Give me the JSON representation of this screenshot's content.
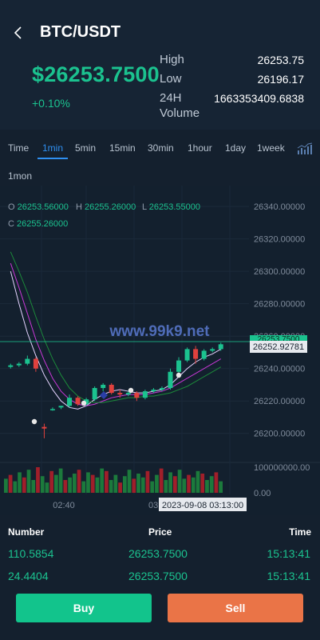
{
  "header": {
    "pair": "BTC/USDT",
    "price": "$26253.7500",
    "change": "+0.10%",
    "stats": [
      {
        "label": "High",
        "value": "26253.75"
      },
      {
        "label": "Low",
        "value": "26196.17"
      },
      {
        "label": "24H",
        "value": "1663353409.6838"
      },
      {
        "label": "Volume",
        "value": ""
      }
    ]
  },
  "tabs": [
    "Time",
    "1min",
    "5min",
    "15min",
    "30min",
    "1hour",
    "1day",
    "1week",
    "1mon"
  ],
  "active_tab": "1min",
  "ohlc": {
    "o_key": "O",
    "o": "26253.56000",
    "h_key": "H",
    "h": "26255.26000",
    "l_key": "L",
    "l": "26253.55000",
    "c_key": "C",
    "c": "26255.26000"
  },
  "watermark": "www.99k9.net",
  "price_axis": [
    "26340.00000",
    "26320.00000",
    "26300.00000",
    "26280.00000",
    "26260.00000",
    "26240.00000",
    "26220.00000",
    "26200.00000"
  ],
  "volume_axis": [
    "100000000.00",
    "0.00"
  ],
  "time_axis": [
    "02:40",
    "03"
  ],
  "crosshair_price": "26252.92781",
  "crosshair_time": "2023-09-08 03:13:00",
  "current_price_label": "26253.7500",
  "colors": {
    "up": "#1bc28f",
    "down": "#e0413e",
    "accent": "#2f8ff0",
    "buy": "#12c48c",
    "sell": "#ea7447"
  },
  "chart_data": {
    "type": "candlestick",
    "ylim": [
      26190,
      26345
    ],
    "candles": [
      {
        "o": 26241,
        "h": 26243,
        "l": 26240,
        "c": 26242
      },
      {
        "o": 26242,
        "h": 26244,
        "l": 26241,
        "c": 26243
      },
      {
        "o": 26243,
        "h": 26248,
        "l": 26242,
        "c": 26246
      },
      {
        "o": 26246,
        "h": 26247,
        "l": 26238,
        "c": 26240
      },
      {
        "o": 26204,
        "h": 26206,
        "l": 26197,
        "c": 26203
      },
      {
        "o": 26215,
        "h": 26216,
        "l": 26214,
        "c": 26215
      },
      {
        "o": 26216,
        "h": 26217,
        "l": 26215,
        "c": 26217
      },
      {
        "o": 26217,
        "h": 26224,
        "l": 26216,
        "c": 26222
      },
      {
        "o": 26222,
        "h": 26223,
        "l": 26217,
        "c": 26218
      },
      {
        "o": 26218,
        "h": 26222,
        "l": 26217,
        "c": 26221
      },
      {
        "o": 26221,
        "h": 26229,
        "l": 26220,
        "c": 26228
      },
      {
        "o": 26228,
        "h": 26231,
        "l": 26226,
        "c": 26230
      },
      {
        "o": 26230,
        "h": 26231,
        "l": 26224,
        "c": 26225
      },
      {
        "o": 26225,
        "h": 26227,
        "l": 26222,
        "c": 26224
      },
      {
        "o": 26224,
        "h": 26226,
        "l": 26223,
        "c": 26225
      },
      {
        "o": 26225,
        "h": 26226,
        "l": 26220,
        "c": 26222
      },
      {
        "o": 26222,
        "h": 26227,
        "l": 26221,
        "c": 26226
      },
      {
        "o": 26226,
        "h": 26228,
        "l": 26225,
        "c": 26227
      },
      {
        "o": 26227,
        "h": 26229,
        "l": 26226,
        "c": 26228
      },
      {
        "o": 26228,
        "h": 26240,
        "l": 26227,
        "c": 26238
      },
      {
        "o": 26238,
        "h": 26247,
        "l": 26236,
        "c": 26245
      },
      {
        "o": 26245,
        "h": 26253,
        "l": 26244,
        "c": 26252
      },
      {
        "o": 26252,
        "h": 26254,
        "l": 26243,
        "c": 26246
      },
      {
        "o": 26246,
        "h": 26252,
        "l": 26245,
        "c": 26251
      },
      {
        "o": 26251,
        "h": 26253,
        "l": 26250,
        "c": 26252
      },
      {
        "o": 26252,
        "h": 26256,
        "l": 26251,
        "c": 26255
      }
    ],
    "volumes": [
      0.55,
      0.7,
      0.45,
      0.8,
      0.6,
      0.9,
      0.5,
      1.0,
      0.65,
      0.4,
      0.85,
      0.7,
      0.95,
      0.5,
      0.6,
      0.75,
      0.9,
      0.45,
      0.8,
      0.7,
      0.6,
      0.95,
      0.85,
      0.5,
      0.7,
      0.4,
      0.65,
      0.9,
      0.55,
      0.75,
      0.6,
      0.85,
      0.45,
      0.7,
      0.95,
      0.5,
      0.8,
      0.65,
      0.9,
      0.55,
      0.7,
      0.6,
      0.85,
      0.75,
      0.5,
      0.65,
      0.8,
      0.45
    ],
    "ma": [
      {
        "color": "#e5d3ff",
        "values": [
          26300,
          26280,
          26262,
          26248,
          26236,
          26227,
          26220,
          26216,
          26215,
          26217,
          26221,
          26224,
          26226,
          26227,
          26226,
          26225,
          26225,
          26226,
          26227,
          26230,
          26235,
          26240,
          26244,
          26247,
          26249,
          26252
        ]
      },
      {
        "color": "#c838d6",
        "values": [
          26305,
          26290,
          26274,
          26258,
          26245,
          26234,
          26226,
          26221,
          26218,
          26217,
          26218,
          26220,
          26222,
          26223,
          26224,
          26224,
          26224,
          26225,
          26226,
          26228,
          26231,
          26234,
          26237,
          26240,
          26243,
          26246
        ]
      },
      {
        "color": "#1c8a3a",
        "values": [
          26312,
          26300,
          26287,
          26272,
          26258,
          26246,
          26236,
          26228,
          26223,
          26220,
          26219,
          26219,
          26220,
          26221,
          26222,
          26222,
          26223,
          26223,
          26224,
          26225,
          26227,
          26229,
          26232,
          26235,
          26238,
          26241
        ]
      }
    ]
  },
  "trades": {
    "headers": [
      "Number",
      "Price",
      "Time"
    ],
    "rows": [
      {
        "number": "110.5854",
        "price": "26253.7500",
        "time": "15:13:41"
      },
      {
        "number": "24.4404",
        "price": "26253.7500",
        "time": "15:13:41"
      }
    ]
  },
  "actions": {
    "buy": "Buy",
    "sell": "Sell"
  }
}
